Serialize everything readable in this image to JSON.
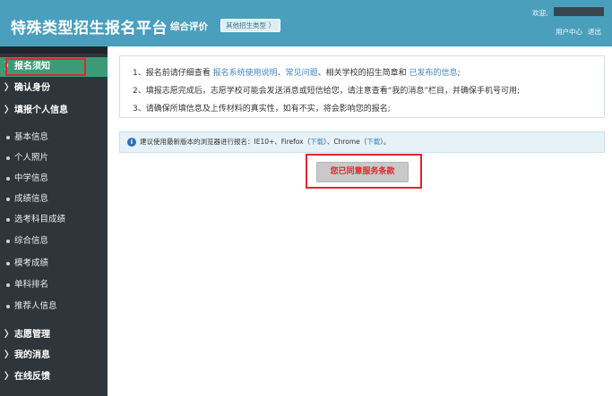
{
  "header": {
    "title": "特殊类型招生报名平台",
    "mode": "综合评价",
    "type_button": "其他招生类型 〉",
    "welcome": "欢迎,",
    "user_center": "用户中心",
    "logout": "退出"
  },
  "sidebar": {
    "nav": [
      {
        "label": "报名须知",
        "active": true
      },
      {
        "label": "确认身份",
        "active": false
      },
      {
        "label": "填报个人信息",
        "active": false
      }
    ],
    "sub_items": [
      "基本信息",
      "个人照片",
      "中学信息",
      "成绩信息",
      "选考科目成绩",
      "综合信息",
      "模考成绩",
      "单科排名",
      "推荐人信息"
    ],
    "bottom_nav": [
      "志愿管理",
      "我的消息",
      "在线反馈"
    ],
    "chevron": "〉"
  },
  "notice": {
    "line1": {
      "prefix": "1、报名前请仔细查看 ",
      "link1": "报名系统使用说明",
      "sep1": "、",
      "link2": "常见问题",
      "mid": "、相关学校的招生简章和 ",
      "link3": "已发布的信息",
      "suffix": ";"
    },
    "line2": "2、填报志愿完成后，志愿学校可能会发送消息或短信给您，请注意查看“我的消息”栏目，并确保手机号可用;",
    "line3": "3、请确保所填信息及上传材料的真实性，如有不实，将会影响您的报名;"
  },
  "browser_tip": {
    "prefix": "建议使用最新版本的浏览器进行报名：IE10+、Firefox（",
    "download1": "下载",
    "mid": "）、Chrome（",
    "download2": "下载",
    "suffix": "）。",
    "icon": "i"
  },
  "agree_button": "您已同意服务条款",
  "colors": {
    "header": "#4a9fbd",
    "sidebar": "#2e353b",
    "active": "#3b9b76",
    "highlight": "#e0262e",
    "link": "#3e85c5"
  }
}
